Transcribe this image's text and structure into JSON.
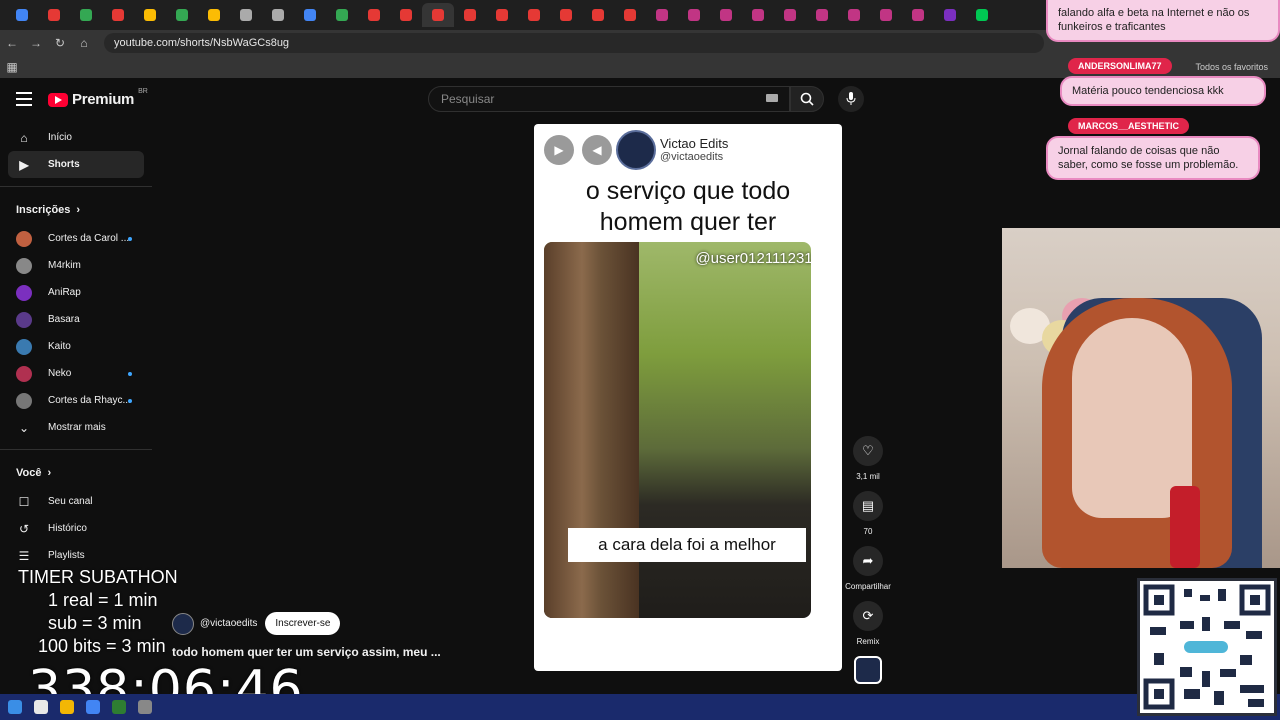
{
  "browser": {
    "url": "youtube.com/shorts/NsbWaGCs8ug",
    "bookmark_right": "Todos os favoritos"
  },
  "youtube": {
    "logo_text": "Premium",
    "logo_badge": "BR",
    "search_placeholder": "Pesquisar"
  },
  "sidebar": {
    "top": [
      {
        "label": "Início",
        "icon": "home-icon"
      },
      {
        "label": "Shorts",
        "icon": "shorts-icon"
      }
    ],
    "subs_header": "Inscrições",
    "subs": [
      {
        "label": "Cortes da Carol ...",
        "color": "#c06040",
        "dot": true
      },
      {
        "label": "M4rkim",
        "color": "#888888",
        "dot": false
      },
      {
        "label": "AniRap",
        "color": "#7b2fbf",
        "dot": false
      },
      {
        "label": "Basara",
        "color": "#5a3a8a",
        "dot": false
      },
      {
        "label": "Kaito",
        "color": "#3a7ab0",
        "dot": false
      },
      {
        "label": "Neko",
        "color": "#b03050",
        "dot": true
      },
      {
        "label": "Cortes da Rhayc...",
        "color": "#777777",
        "dot": true
      }
    ],
    "show_more": "Mostrar mais",
    "you_header": "Você",
    "you": [
      {
        "label": "Seu canal",
        "icon": "channel-icon"
      },
      {
        "label": "Histórico",
        "icon": "history-icon"
      },
      {
        "label": "Playlists",
        "icon": "playlists-icon"
      }
    ]
  },
  "short": {
    "channel_name": "Victao Edits",
    "channel_handle": "@victaoedits",
    "caption_top": "o serviço que todo homem quer ter",
    "watermark_user": "@user0121112312",
    "caption_bottom": "a cara dela foi a melhor",
    "like_count": "3,1 mil",
    "comment_count": "70",
    "share_label": "Compartilhar",
    "remix_label": "Remix",
    "below_handle": "@victaoedits",
    "subscribe_label": "Inscrever-se",
    "title": "todo homem quer ter um serviço assim, meu ..."
  },
  "overlay": {
    "timer_title": "TIMER SUBATHON",
    "rule1": "1 real = 1 min",
    "rule2": "sub = 3 min",
    "rule3": "100 bits = 3 min",
    "clock": "338:06:46"
  },
  "chat": [
    {
      "user": "",
      "text": "falando alfa e beta na Internet e não os funkeiros e traficantes"
    },
    {
      "user": "ANDERSONLIMA77",
      "text": "Matéria pouco tendenciosa kkk"
    },
    {
      "user": "MARCOS__AESTHETIC",
      "text": "Jornal falando de coisas que não saber, como se fosse um problemão."
    }
  ],
  "colors": {
    "yt_red": "#ff0033",
    "chat_bubble": "#f7d0e6",
    "chat_border": "#e98ac1",
    "nametag": "#e0254a",
    "taskbar": "#1a2a6c"
  }
}
